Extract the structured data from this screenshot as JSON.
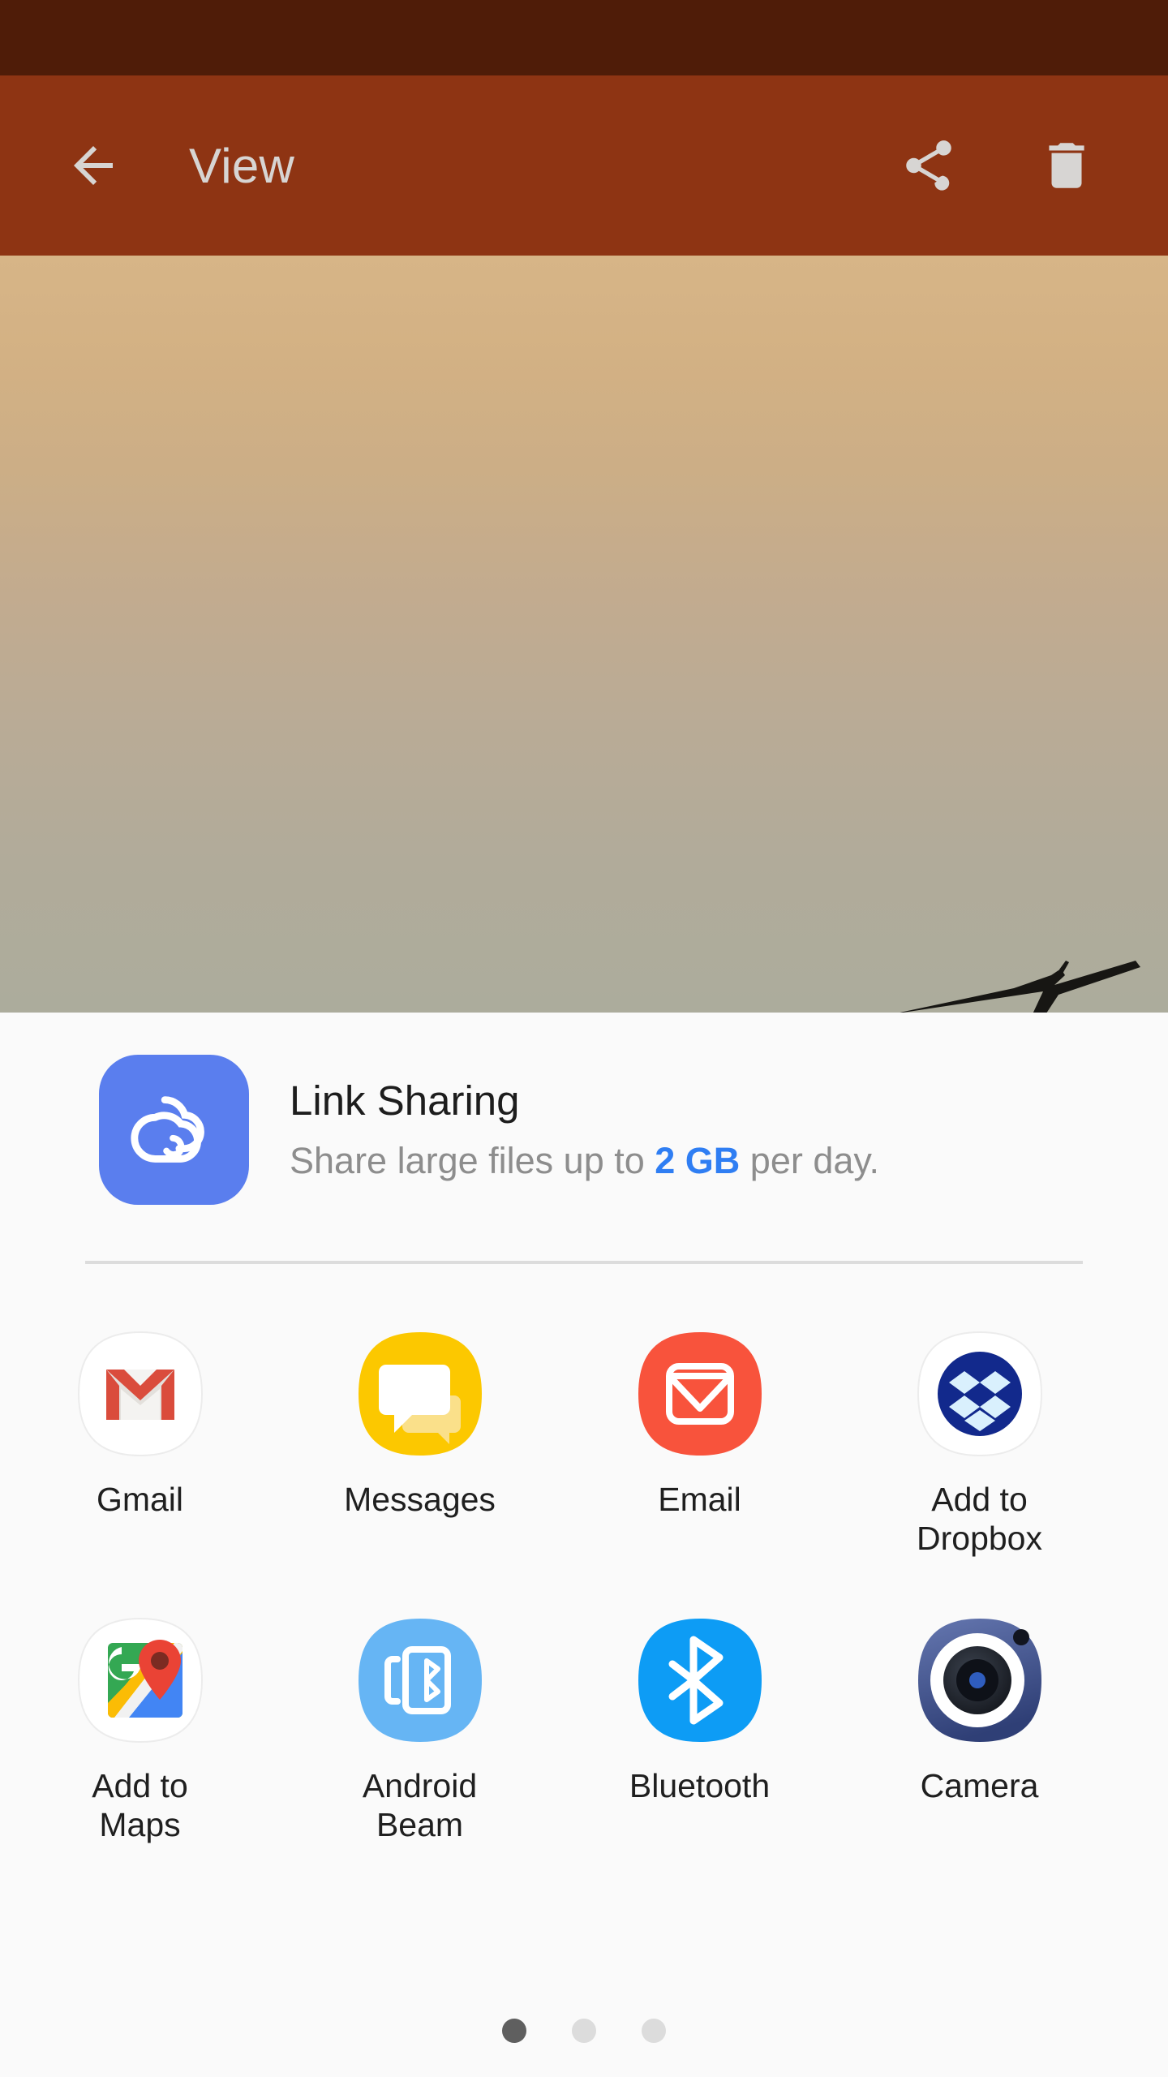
{
  "status_bar": {
    "background": "#4f1c08"
  },
  "app_bar": {
    "background": "#8e3413",
    "title": "View",
    "back_icon": "arrow-left-icon",
    "actions": [
      {
        "name": "share-icon",
        "label": "Share"
      },
      {
        "name": "delete-icon",
        "label": "Delete"
      }
    ]
  },
  "photo": {
    "description": "Sky gradient photo with branch silhouette",
    "gradient_top": "#d7b587",
    "gradient_bottom": "#acac9c",
    "foreground": "branch-silhouette"
  },
  "share_sheet": {
    "background": "#fafafa",
    "link_sharing": {
      "icon": "cloud-link-icon",
      "icon_background": "#5a7eee",
      "title": "Link Sharing",
      "subtitle_prefix": "Share large files up to ",
      "subtitle_highlight": "2 GB",
      "subtitle_suffix": " per day.",
      "highlight_color": "#2f7ef3"
    },
    "apps": [
      [
        {
          "name": "share-target-gmail",
          "icon": "gmail-icon",
          "label": "Gmail"
        },
        {
          "name": "share-target-messages",
          "icon": "messages-icon",
          "label": "Messages"
        },
        {
          "name": "share-target-email",
          "icon": "email-icon",
          "label": "Email"
        },
        {
          "name": "share-target-dropbox",
          "icon": "dropbox-icon",
          "label": "Add to Dropbox"
        }
      ],
      [
        {
          "name": "share-target-maps",
          "icon": "google-maps-icon",
          "label": "Add to Maps"
        },
        {
          "name": "share-target-android-beam",
          "icon": "android-beam-icon",
          "label": "Android Beam"
        },
        {
          "name": "share-target-bluetooth",
          "icon": "bluetooth-icon",
          "label": "Bluetooth"
        },
        {
          "name": "share-target-camera",
          "icon": "camera-icon",
          "label": "Camera"
        }
      ]
    ],
    "pager": {
      "total": 3,
      "active_index": 0,
      "active_color": "#5f5f5f",
      "inactive_color": "#dcdcdc"
    }
  }
}
